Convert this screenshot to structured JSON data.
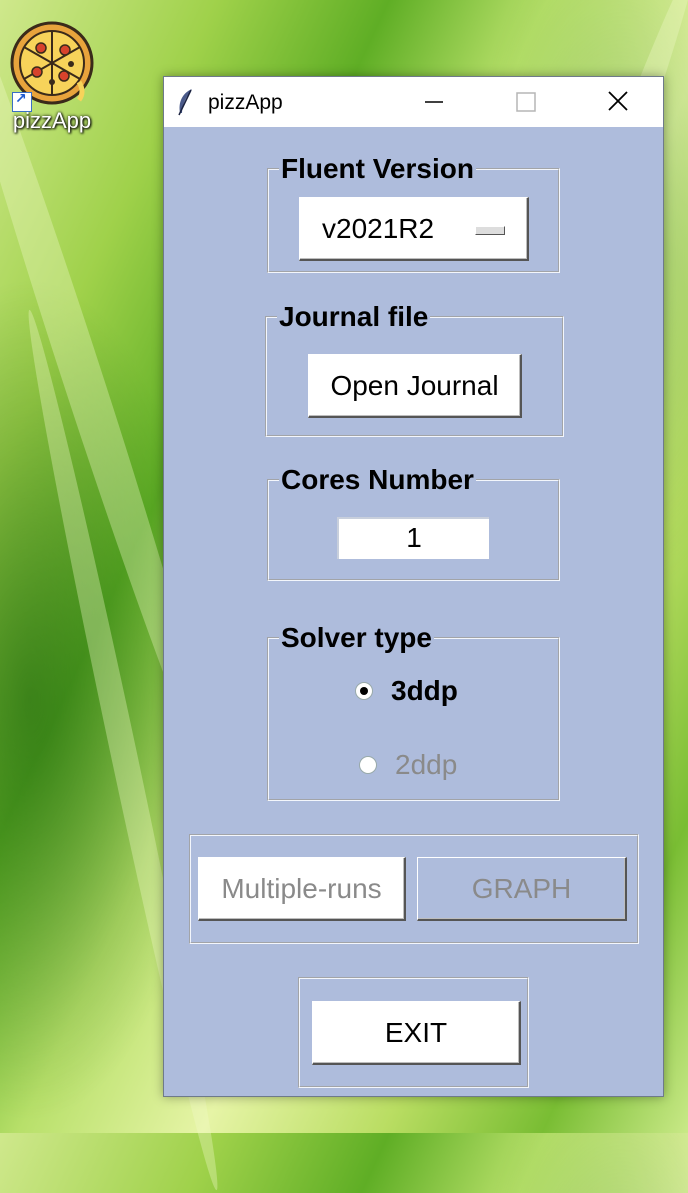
{
  "desktop": {
    "icon_label": "pizzApp"
  },
  "window": {
    "title": "pizzApp",
    "fluent_group": {
      "legend": "Fluent Version",
      "selected_version": "v2021R2"
    },
    "journal_group": {
      "legend": "Journal file",
      "button_label": "Open Journal"
    },
    "cores_group": {
      "legend": "Cores Number",
      "value": "1"
    },
    "solver_group": {
      "legend": "Solver type",
      "options": [
        {
          "label": "3ddp",
          "checked": true,
          "enabled": true
        },
        {
          "label": "2ddp",
          "checked": false,
          "enabled": false
        }
      ]
    },
    "actions": {
      "multiple_runs_label": "Multiple-runs",
      "graph_label": "GRAPH"
    },
    "exit_label": "EXIT"
  }
}
